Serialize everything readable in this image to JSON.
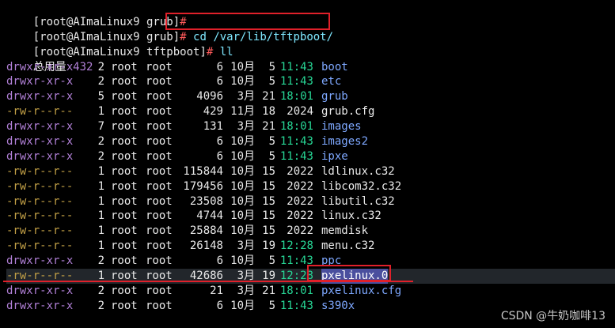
{
  "prompt_grub": "[root@AImaLinux9 grub]",
  "prompt_tftp": "[root@AImaLinux9 tftpboot]",
  "hash": "#",
  "cmd_cd": "cd /var/lib/tftpboot/",
  "cmd_ll": "ll",
  "total_label": "总用量",
  "total_value": "432",
  "entries": [
    {
      "perm": "drwxr-xr-x",
      "links": "2",
      "owner": "root",
      "group": "root",
      "size": "6",
      "month": "10月",
      "day": "5",
      "time": "11:43",
      "name": "boot",
      "kind": "dir"
    },
    {
      "perm": "drwxr-xr-x",
      "links": "2",
      "owner": "root",
      "group": "root",
      "size": "6",
      "month": "10月",
      "day": "5",
      "time": "11:43",
      "name": "etc",
      "kind": "dir"
    },
    {
      "perm": "drwxr-xr-x",
      "links": "5",
      "owner": "root",
      "group": "root",
      "size": "4096",
      "month": "3月",
      "day": "21",
      "time": "18:01",
      "name": "grub",
      "kind": "dir"
    },
    {
      "perm": "-rw-r--r--",
      "links": "1",
      "owner": "root",
      "group": "root",
      "size": "429",
      "month": "11月",
      "day": "18",
      "time": "2024",
      "name": "grub.cfg",
      "kind": "file"
    },
    {
      "perm": "drwxr-xr-x",
      "links": "7",
      "owner": "root",
      "group": "root",
      "size": "131",
      "month": "3月",
      "day": "21",
      "time": "18:01",
      "name": "images",
      "kind": "dir"
    },
    {
      "perm": "drwxr-xr-x",
      "links": "2",
      "owner": "root",
      "group": "root",
      "size": "6",
      "month": "10月",
      "day": "5",
      "time": "11:43",
      "name": "images2",
      "kind": "dir"
    },
    {
      "perm": "drwxr-xr-x",
      "links": "2",
      "owner": "root",
      "group": "root",
      "size": "6",
      "month": "10月",
      "day": "5",
      "time": "11:43",
      "name": "ipxe",
      "kind": "dir"
    },
    {
      "perm": "-rw-r--r--",
      "links": "1",
      "owner": "root",
      "group": "root",
      "size": "115844",
      "month": "10月",
      "day": "15",
      "time": "2022",
      "name": "ldlinux.c32",
      "kind": "file"
    },
    {
      "perm": "-rw-r--r--",
      "links": "1",
      "owner": "root",
      "group": "root",
      "size": "179456",
      "month": "10月",
      "day": "15",
      "time": "2022",
      "name": "libcom32.c32",
      "kind": "file"
    },
    {
      "perm": "-rw-r--r--",
      "links": "1",
      "owner": "root",
      "group": "root",
      "size": "23508",
      "month": "10月",
      "day": "15",
      "time": "2022",
      "name": "libutil.c32",
      "kind": "file"
    },
    {
      "perm": "-rw-r--r--",
      "links": "1",
      "owner": "root",
      "group": "root",
      "size": "4744",
      "month": "10月",
      "day": "15",
      "time": "2022",
      "name": "linux.c32",
      "kind": "file"
    },
    {
      "perm": "-rw-r--r--",
      "links": "1",
      "owner": "root",
      "group": "root",
      "size": "25884",
      "month": "10月",
      "day": "15",
      "time": "2022",
      "name": "memdisk",
      "kind": "file"
    },
    {
      "perm": "-rw-r--r--",
      "links": "1",
      "owner": "root",
      "group": "root",
      "size": "26148",
      "month": "3月",
      "day": "19",
      "time": "12:28",
      "name": "menu.c32",
      "kind": "file"
    },
    {
      "perm": "drwxr-xr-x",
      "links": "2",
      "owner": "root",
      "group": "root",
      "size": "6",
      "month": "10月",
      "day": "5",
      "time": "11:43",
      "name": "ppc",
      "kind": "dir"
    },
    {
      "perm": "-rw-r--r--",
      "links": "1",
      "owner": "root",
      "group": "root",
      "size": "42686",
      "month": "3月",
      "day": "19",
      "time": "12:28",
      "name": "pxelinux.0",
      "kind": "file",
      "highlight": true
    },
    {
      "perm": "drwxr-xr-x",
      "links": "2",
      "owner": "root",
      "group": "root",
      "size": "21",
      "month": "3月",
      "day": "21",
      "time": "18:01",
      "name": "pxelinux.cfg",
      "kind": "dir"
    },
    {
      "perm": "drwxr-xr-x",
      "links": "2",
      "owner": "root",
      "group": "root",
      "size": "6",
      "month": "10月",
      "day": "5",
      "time": "11:43",
      "name": "s390x",
      "kind": "dir"
    }
  ],
  "watermark": "CSDN @牛奶咖啡13",
  "colors": {
    "annotation_red": "#e0202a",
    "cursor": "#f3a72b",
    "dir_name": "#7ea8ff",
    "time": "#27d796"
  }
}
